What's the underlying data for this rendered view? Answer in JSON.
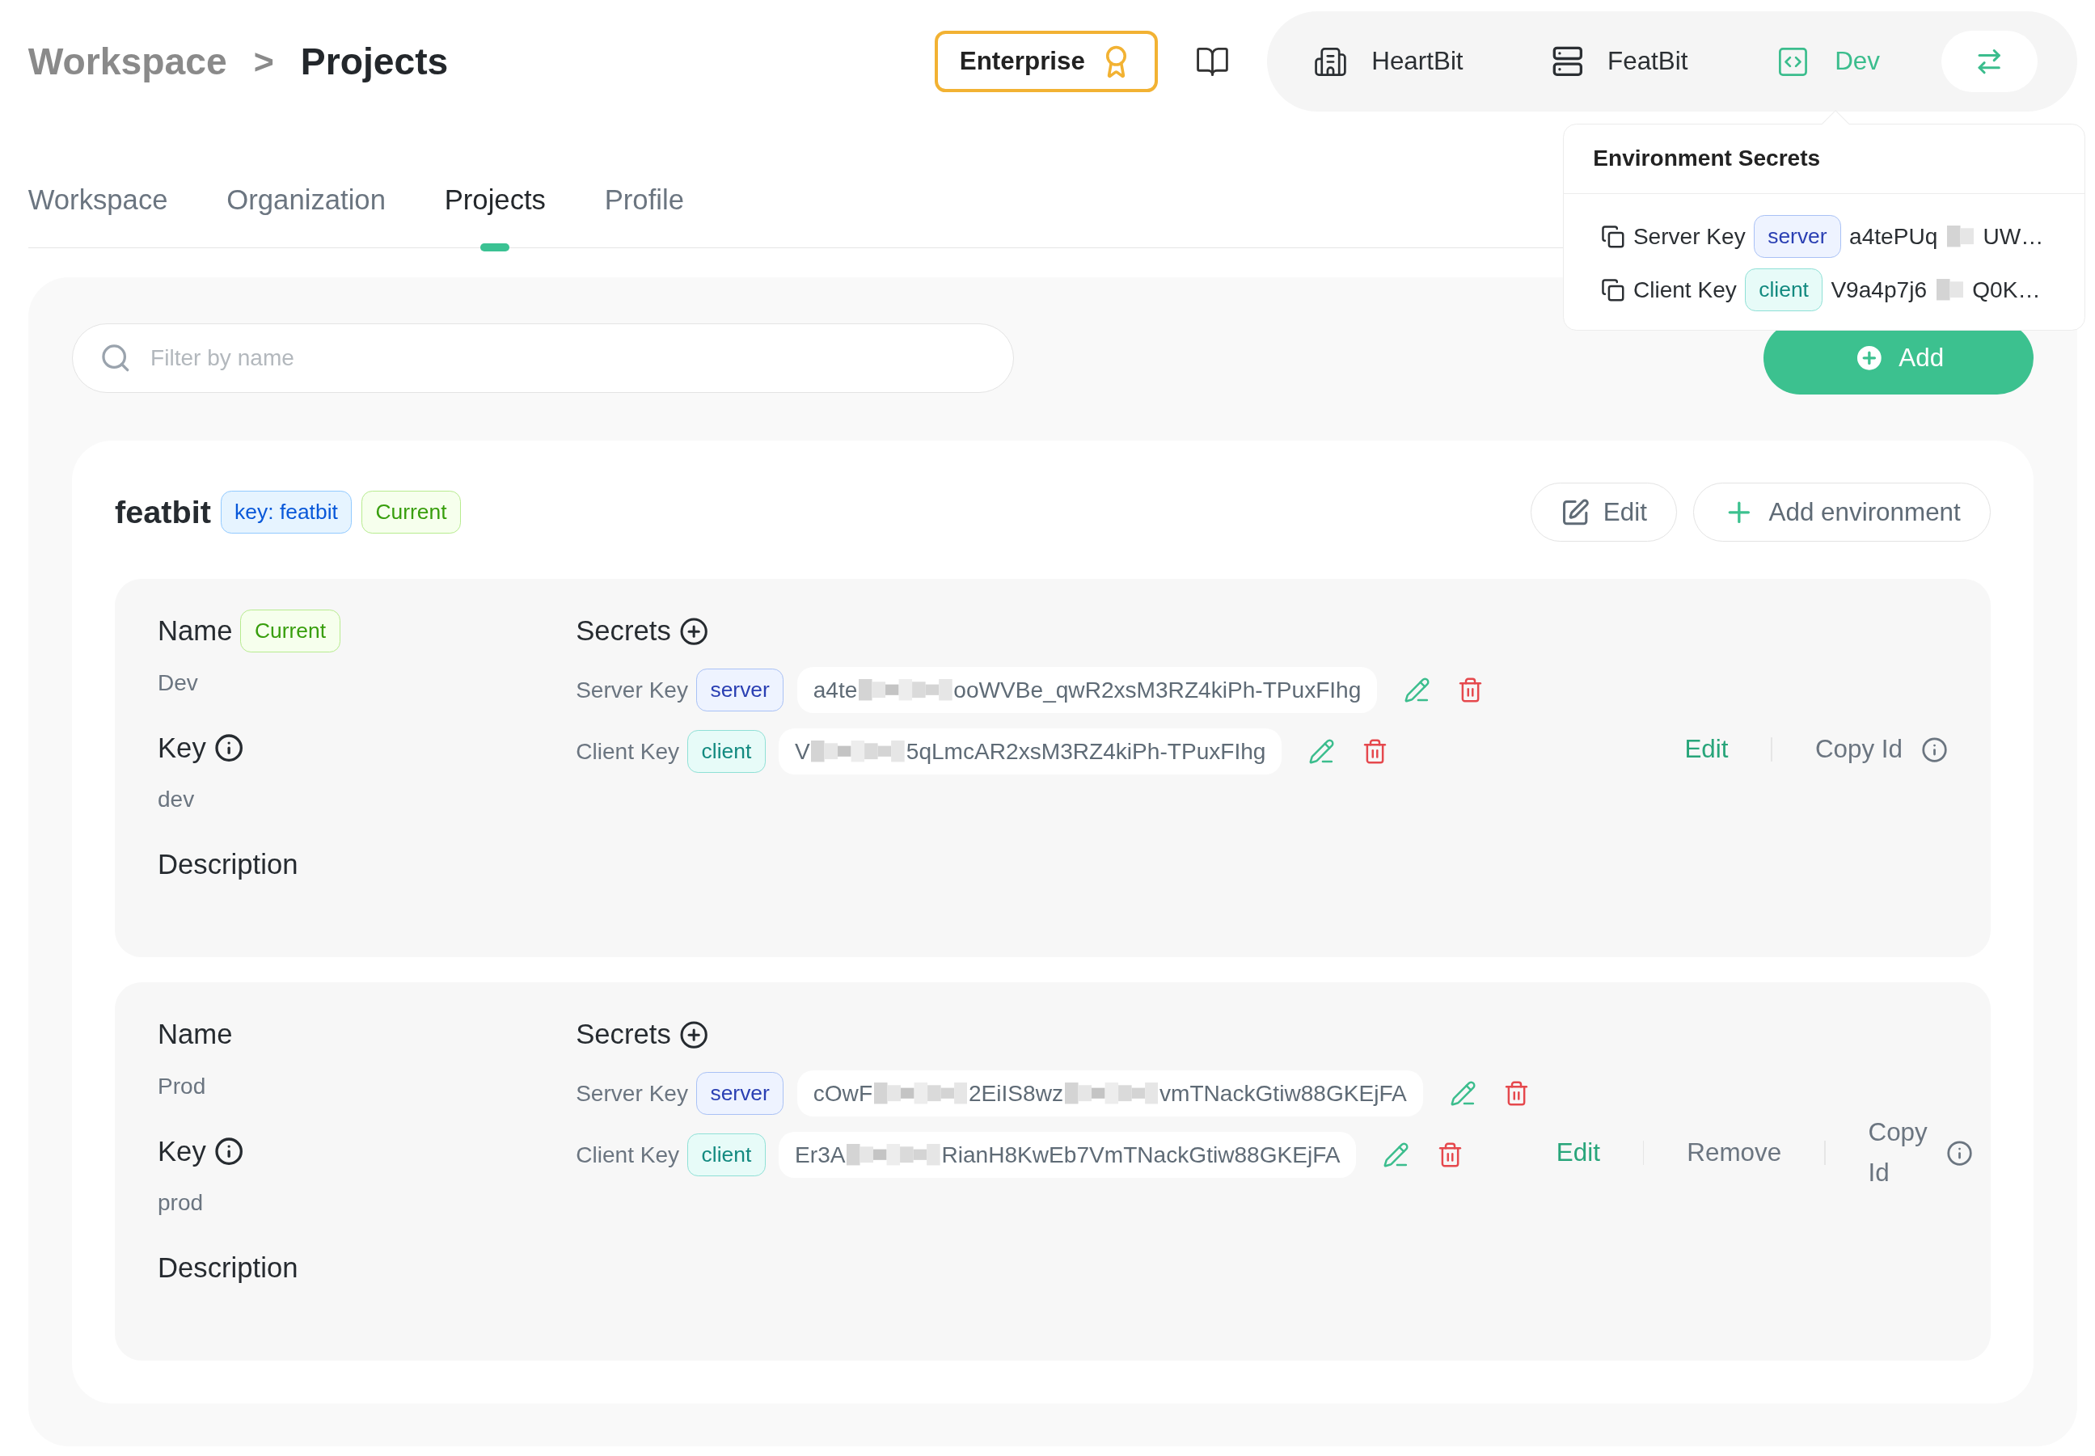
{
  "breadcrumb": [
    {
      "label": "Workspace",
      "selected": false
    },
    {
      "label": "Projects",
      "selected": true
    }
  ],
  "breadcrumb_separator": ">",
  "plan_button": {
    "label": "Enterprise"
  },
  "nav": {
    "items": [
      {
        "label": "HeartBit",
        "kind": "organization",
        "selected": false
      },
      {
        "label": "FeatBit",
        "kind": "project",
        "selected": false
      },
      {
        "label": "Dev",
        "kind": "environment",
        "selected": true
      }
    ]
  },
  "popover": {
    "title": "Environment Secrets",
    "secrets": [
      {
        "label": "Server Key",
        "kind": "server",
        "tag": "server",
        "value_parts": [
          "a4tePUq",
          "UW…"
        ]
      },
      {
        "label": "Client Key",
        "kind": "client",
        "tag": "client",
        "value_parts": [
          "V9a4p7j6",
          "Q0K…"
        ]
      }
    ]
  },
  "tabs": [
    {
      "label": "Workspace",
      "selected": false
    },
    {
      "label": "Organization",
      "selected": false
    },
    {
      "label": "Projects",
      "selected": true
    },
    {
      "label": "Profile",
      "selected": false
    }
  ],
  "search": {
    "placeholder": "Filter by name"
  },
  "add_button": {
    "label": "Add"
  },
  "project": {
    "name": "featbit",
    "tags": [
      {
        "text": "key: featbit",
        "kind": "key"
      },
      {
        "text": "Current",
        "kind": "current"
      }
    ],
    "actions": [
      {
        "label": "Edit",
        "kind": "edit"
      },
      {
        "label": "Add environment",
        "kind": "add"
      }
    ],
    "environments": [
      {
        "name_label": "Name",
        "tag": "Current",
        "name": "Dev",
        "key_label": "Key",
        "key": "dev",
        "description_label": "Description",
        "secrets_label": "Secrets",
        "secrets": [
          {
            "label": "Server Key",
            "kind": "server",
            "tag": "server",
            "value_parts": [
              "a4te",
              "ooWVBe_qwR2xsM3RZ4kiPh-TPuxFIhg"
            ]
          },
          {
            "label": "Client Key",
            "kind": "client",
            "tag": "client",
            "value_parts": [
              "V",
              "5qLmcAR2xsM3RZ4kiPh-TPuxFIhg"
            ]
          }
        ],
        "actions": [
          {
            "label": "Edit",
            "kind": "edit"
          },
          {
            "label": "Copy Id",
            "kind": "copy"
          }
        ]
      },
      {
        "name_label": "Name",
        "name": "Prod",
        "key_label": "Key",
        "key": "prod",
        "description_label": "Description",
        "secrets_label": "Secrets",
        "secrets": [
          {
            "label": "Server Key",
            "kind": "server",
            "tag": "server",
            "value_parts": [
              "cOwF",
              "2EiIS8wz",
              "vmTNackGtiw88GKEjFA"
            ]
          },
          {
            "label": "Client Key",
            "kind": "client",
            "tag": "client",
            "value_parts": [
              "Er3A",
              "RianH8KwEb7VmTNackGtiw88GKEjFA"
            ]
          }
        ],
        "actions": [
          {
            "label": "Edit",
            "kind": "edit"
          },
          {
            "label": "Remove",
            "kind": "remove"
          },
          {
            "label": "Copy Id",
            "kind": "copy"
          }
        ]
      }
    ]
  }
}
